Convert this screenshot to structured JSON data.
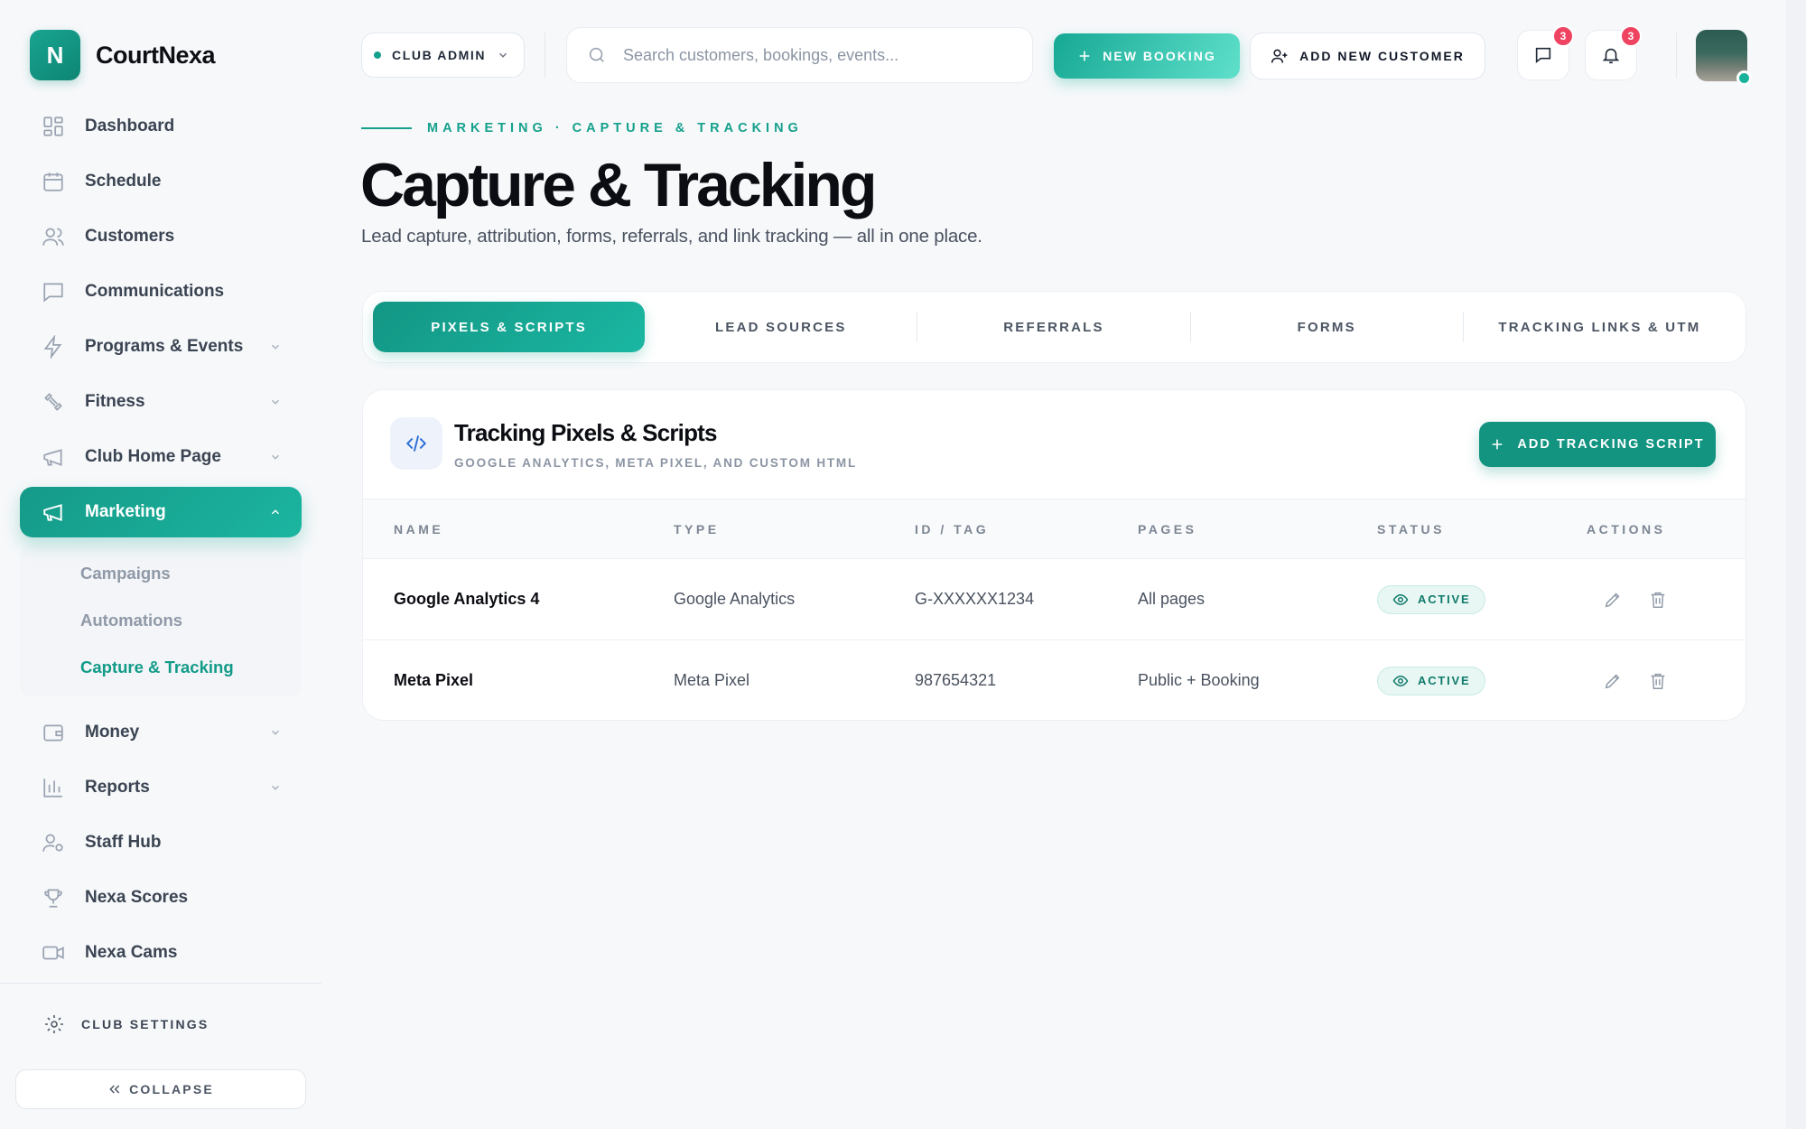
{
  "app": {
    "logo_letter": "N",
    "name": "CourtNexa"
  },
  "sidebar": {
    "items": [
      {
        "label": "Dashboard",
        "icon": "dashboard-grid-icon"
      },
      {
        "label": "Schedule",
        "icon": "calendar-icon"
      },
      {
        "label": "Customers",
        "icon": "users-icon"
      },
      {
        "label": "Communications",
        "icon": "chat-icon"
      },
      {
        "label": "Programs & Events",
        "icon": "lightning-icon",
        "expandable": true
      },
      {
        "label": "Fitness",
        "icon": "dumbbell-icon",
        "expandable": true
      },
      {
        "label": "Club Home Page",
        "icon": "megaphone-icon",
        "expandable": true
      },
      {
        "label": "Marketing",
        "icon": "megaphone-icon",
        "expandable": true,
        "active": true
      },
      {
        "label": "Money",
        "icon": "wallet-icon",
        "expandable": true
      },
      {
        "label": "Reports",
        "icon": "bar-chart-icon",
        "expandable": true
      },
      {
        "label": "Staff Hub",
        "icon": "staff-icon"
      },
      {
        "label": "Nexa Scores",
        "icon": "trophy-icon"
      },
      {
        "label": "Nexa Cams",
        "icon": "video-camera-icon"
      }
    ],
    "marketing_subitems": [
      {
        "label": "Campaigns"
      },
      {
        "label": "Automations"
      },
      {
        "label": "Capture & Tracking",
        "active": true
      }
    ],
    "club_settings": "CLUB SETTINGS",
    "collapse": "COLLAPSE"
  },
  "topbar": {
    "role": "CLUB ADMIN",
    "search_placeholder": "Search customers, bookings, events...",
    "new_booking": "NEW BOOKING",
    "add_customer": "ADD NEW CUSTOMER",
    "messages_count": "3",
    "notifications_count": "3"
  },
  "page": {
    "eyebrow": "MARKETING · CAPTURE & TRACKING",
    "title": "Capture & Tracking",
    "subtitle": "Lead capture, attribution, forms, referrals, and link tracking — all in one place."
  },
  "tabs": [
    {
      "label": "PIXELS & SCRIPTS",
      "active": true
    },
    {
      "label": "LEAD SOURCES"
    },
    {
      "label": "REFERRALS"
    },
    {
      "label": "FORMS"
    },
    {
      "label": "TRACKING LINKS & UTM"
    }
  ],
  "card": {
    "title": "Tracking Pixels & Scripts",
    "subtitle": "GOOGLE ANALYTICS, META PIXEL, AND CUSTOM HTML",
    "add_button": "ADD TRACKING SCRIPT",
    "columns": [
      "NAME",
      "TYPE",
      "ID / TAG",
      "PAGES",
      "STATUS",
      "ACTIONS"
    ],
    "rows": [
      {
        "name": "Google Analytics 4",
        "type": "Google Analytics",
        "id": "G-XXXXXX1234",
        "pages": "All pages",
        "status": "ACTIVE"
      },
      {
        "name": "Meta Pixel",
        "type": "Meta Pixel",
        "id": "987654321",
        "pages": "Public + Booking",
        "status": "ACTIVE"
      }
    ]
  },
  "colors": {
    "accent": "#14a08c",
    "badge": "#ef4461",
    "card_icon": "#2f6fd6"
  }
}
